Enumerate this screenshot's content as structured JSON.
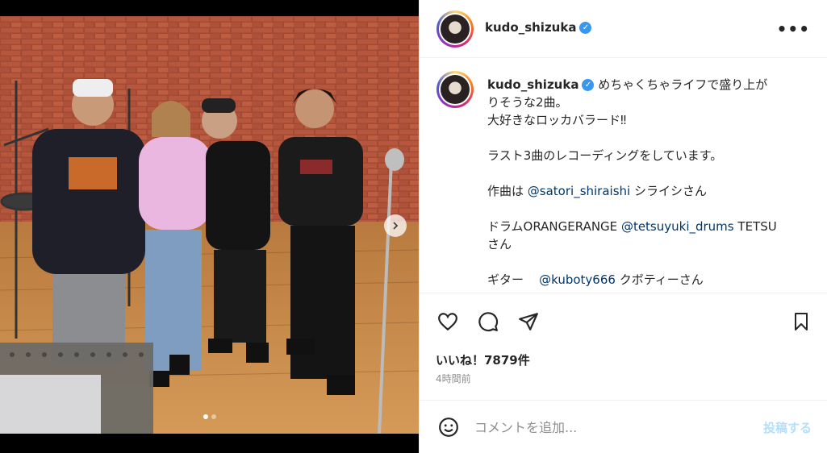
{
  "post": {
    "username": "kudo_shizuka",
    "verified": true,
    "caption_lines": [
      "めちゃくちゃライフで盛り上が",
      "りそうな2曲。",
      "大好きなロッカバラード‼︎",
      "",
      "ラスト3曲のレコーディングをしています。",
      "",
      "作曲は",
      "@satori_shiraishi",
      "シライシさん",
      "",
      "ドラムORANGERANGE",
      "@tetsuyuki_drums",
      "TETSU",
      "さん",
      "",
      "ギター",
      "@kuboty666",
      "クボティーさん"
    ],
    "likes_text": "いいね！7879件",
    "time_ago": "4時間前",
    "photo_dots": 2,
    "active_dot": 0
  },
  "comment": {
    "placeholder": "コメントを追加...",
    "post_label": "投稿する"
  },
  "colors": {
    "verified": "#3897f0",
    "mention": "#00376b",
    "post_disabled": "#b2dffc",
    "brick": "#a4442e",
    "floor": "#c98a4b"
  },
  "icons": [
    "more-options-icon",
    "heart-icon",
    "comment-icon",
    "share-icon",
    "bookmark-icon",
    "emoji-icon",
    "chevron-right-icon"
  ]
}
